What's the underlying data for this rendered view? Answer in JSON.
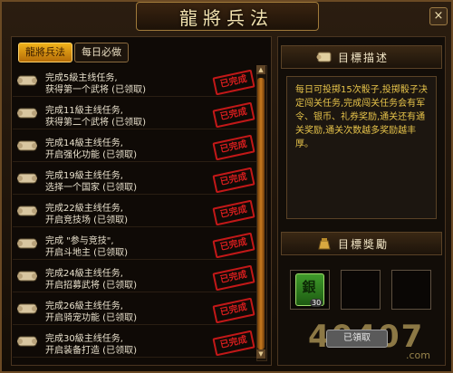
{
  "window": {
    "title": "龍將兵法",
    "close_glyph": "×"
  },
  "tabs": [
    {
      "label": "龍將兵法"
    },
    {
      "label": "每日必做"
    }
  ],
  "tasks": [
    {
      "line1": "完成5級主线任务,",
      "line2": "获得第一个武将 (已领取)",
      "stamp": "已完成"
    },
    {
      "line1": "完成11級主线任务,",
      "line2": "获得第二个武将 (已领取)",
      "stamp": "已完成"
    },
    {
      "line1": "完成14級主线任务,",
      "line2": "开启强化功能 (已领取)",
      "stamp": "已完成"
    },
    {
      "line1": "完成19級主线任务,",
      "line2": "选择一个国家 (已领取)",
      "stamp": "已完成"
    },
    {
      "line1": "完成22級主线任务,",
      "line2": "开启竞技场 (已领取)",
      "stamp": "已完成"
    },
    {
      "line1": "完成 \"参与竞技\",",
      "line2": "开启斗地主 (已领取)",
      "stamp": "已完成"
    },
    {
      "line1": "完成24級主线任务,",
      "line2": "开启招募武将 (已领取)",
      "stamp": "已完成"
    },
    {
      "line1": "完成26級主线任务,",
      "line2": "开启骑宠功能 (已领取)",
      "stamp": "已完成"
    },
    {
      "line1": "完成30級主线任务,",
      "line2": "开启装备打造 (已领取)",
      "stamp": "已完成"
    }
  ],
  "goal": {
    "heading": "目標描述",
    "description": "每日可投掷15次骰子,投掷骰子决定闯关任务,完成闯关任务会有军令、银币、礼券奖励,通关还有通关奖励,通关次数越多奖励越丰厚。"
  },
  "reward": {
    "heading": "目標獎勵",
    "items": [
      {
        "glyph": "銀",
        "quantity": "30"
      }
    ],
    "claim_label": "已領取"
  },
  "watermark": {
    "text": "40407",
    "suffix": ".com"
  },
  "colors": {
    "accent": "#f0b21a",
    "stamp": "#d81e1e",
    "description_text": "#e6c34a",
    "reward_green": "#3f9a2a"
  }
}
